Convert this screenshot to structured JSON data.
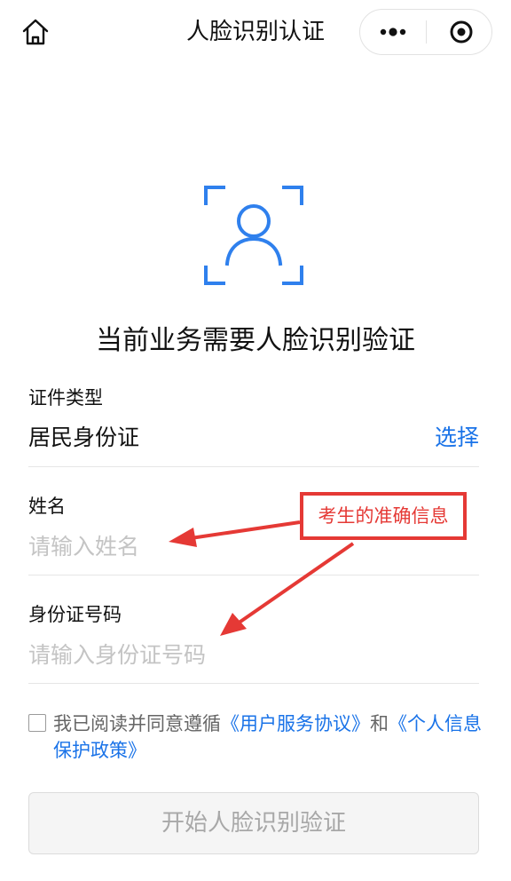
{
  "navbar": {
    "title": "人脸识别认证",
    "home_icon": "home-icon",
    "more_icon": "more-dots-icon",
    "close_icon": "target-close-icon"
  },
  "main": {
    "face_icon": "face-scan-icon",
    "headline": "当前业务需要人脸识别验证"
  },
  "form": {
    "cert_type": {
      "label": "证件类型",
      "value": "居民身份证",
      "action": "选择"
    },
    "name": {
      "label": "姓名",
      "placeholder": "请输入姓名"
    },
    "id_number": {
      "label": "身份证号码",
      "placeholder": "请输入身份证号码"
    }
  },
  "annotation": {
    "text": "考生的准确信息",
    "color": "#e53935"
  },
  "agreement": {
    "prefix": "我已阅读并同意遵循",
    "link1": "《用户服务协议》",
    "middle": "和",
    "link2": "《个人信息保护政策》"
  },
  "start_button": {
    "label": "开始人脸识别验证"
  },
  "colors": {
    "accent": "#1a73e8",
    "face_icon": "#2f80ed",
    "annotation": "#e53935"
  }
}
